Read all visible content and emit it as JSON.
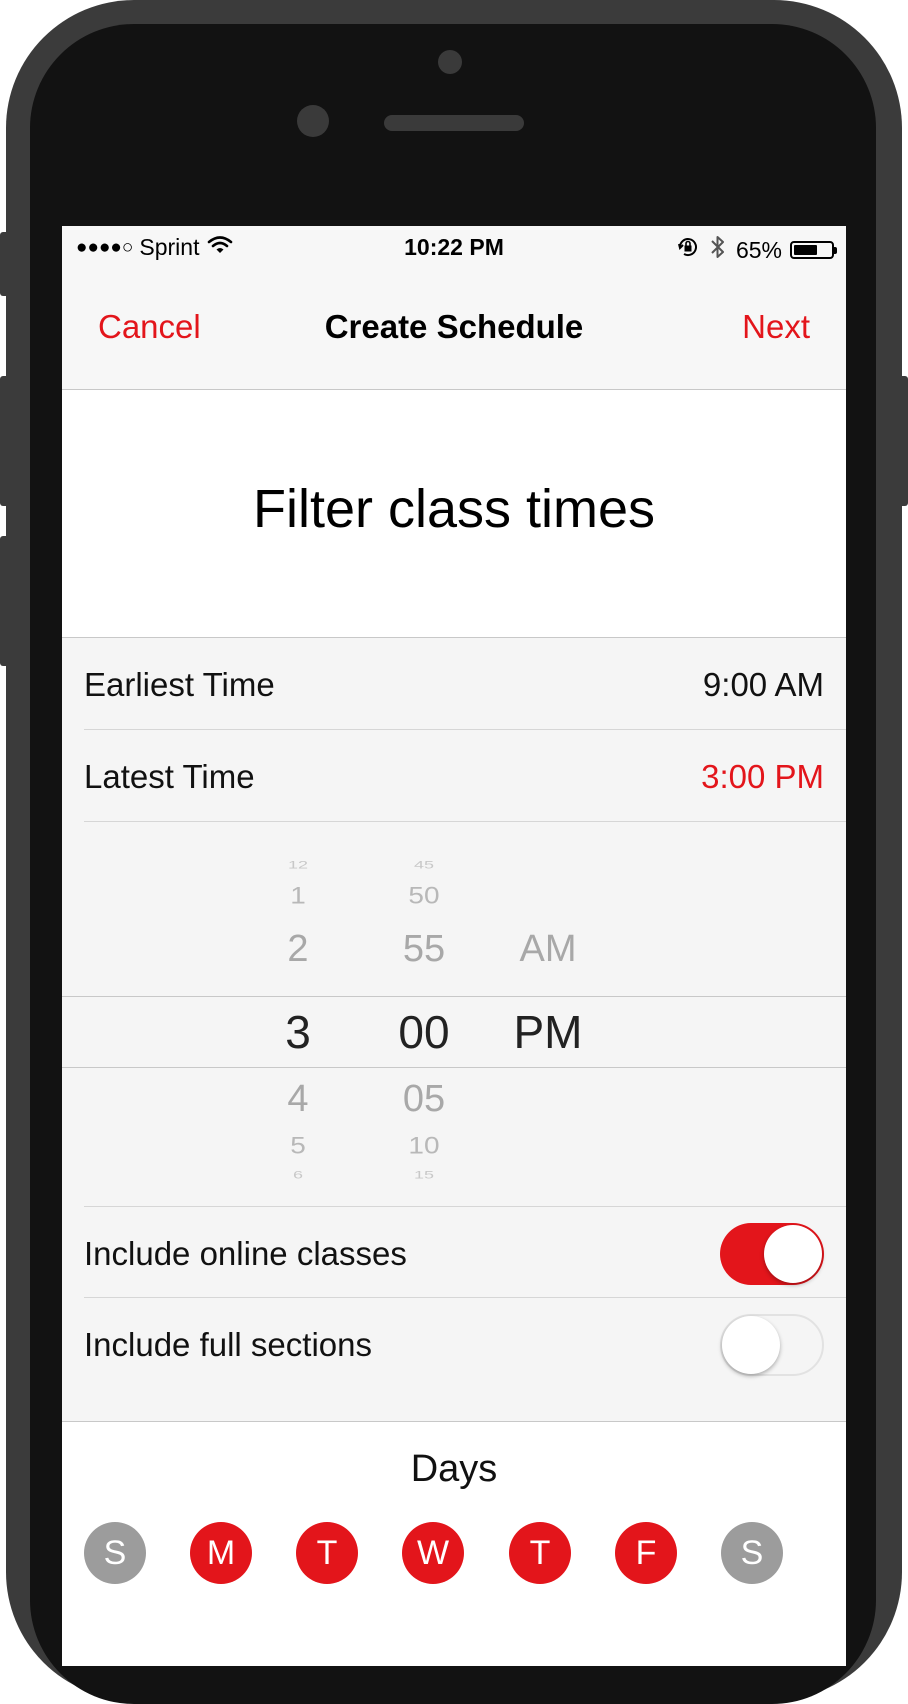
{
  "status_bar": {
    "signal": "●●●●○",
    "carrier": "Sprint",
    "time": "10:22 PM",
    "battery_percent": "65%",
    "battery_level": 0.65,
    "icons": [
      "wifi-icon",
      "rotation-lock-icon",
      "bluetooth-icon",
      "battery-icon"
    ]
  },
  "nav": {
    "cancel_label": "Cancel",
    "title": "Create Schedule",
    "next_label": "Next"
  },
  "heading": "Filter class times",
  "time_filters": [
    {
      "label": "Earliest Time",
      "value": "9:00 AM",
      "active": false
    },
    {
      "label": "Latest Time",
      "value": "3:00 PM",
      "active": true
    }
  ],
  "picker": {
    "hours": [
      "12",
      "1",
      "2",
      "3",
      "4",
      "5",
      "6"
    ],
    "minutes": [
      "45",
      "50",
      "55",
      "00",
      "05",
      "10",
      "15"
    ],
    "periods": [
      "AM",
      "PM"
    ],
    "selected": {
      "hour": "3",
      "minute": "00",
      "period": "PM"
    }
  },
  "options": [
    {
      "label": "Include online classes",
      "enabled": true
    },
    {
      "label": "Include full sections",
      "enabled": false
    }
  ],
  "days": {
    "title": "Days",
    "items": [
      {
        "letter": "S",
        "selected": false
      },
      {
        "letter": "M",
        "selected": true
      },
      {
        "letter": "T",
        "selected": true
      },
      {
        "letter": "W",
        "selected": true
      },
      {
        "letter": "T",
        "selected": true
      },
      {
        "letter": "F",
        "selected": true
      },
      {
        "letter": "S",
        "selected": false
      }
    ]
  },
  "colors": {
    "accent": "#e3151b",
    "day_off": "#9c9c9c",
    "frame": "#3b3b3b"
  }
}
